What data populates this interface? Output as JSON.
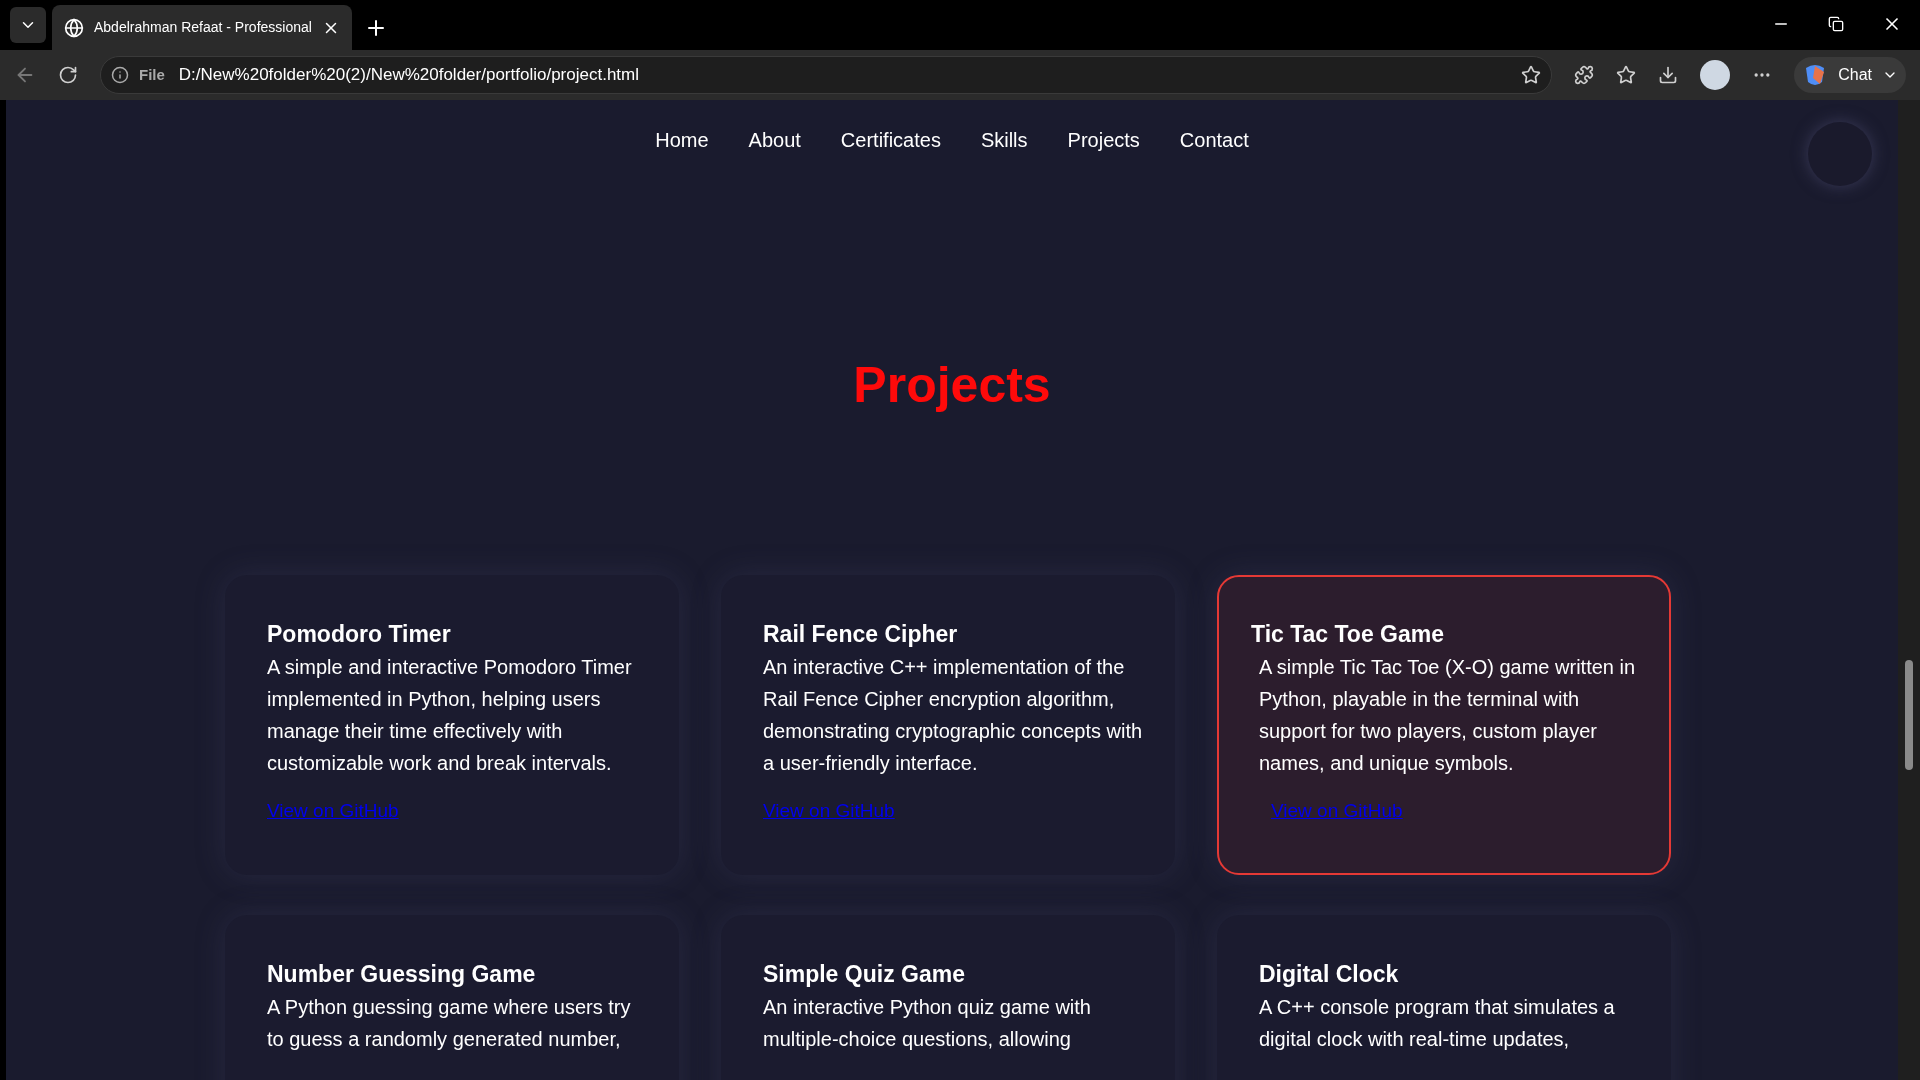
{
  "browser": {
    "tab": {
      "title": "Abdelrahman Refaat - Professional"
    },
    "address": {
      "scheme": "File",
      "url": "D:/New%20folder%20(2)/New%20folder/portfolio/project.html"
    },
    "chat_button": "Chat"
  },
  "nav": [
    {
      "label": "Home"
    },
    {
      "label": "About"
    },
    {
      "label": "Certificates"
    },
    {
      "label": "Skills"
    },
    {
      "label": "Projects"
    },
    {
      "label": "Contact"
    }
  ],
  "heading": "Projects",
  "projects": [
    {
      "title": "Pomodoro Timer",
      "description": "A simple and interactive Pomodoro Timer implemented in Python, helping users manage their time effectively with customizable work and break intervals.",
      "link": "View on GitHub",
      "highlighted": false
    },
    {
      "title": "Rail Fence Cipher",
      "description": "An interactive C++ implementation of the Rail Fence Cipher encryption algorithm, demonstrating cryptographic concepts with a user-friendly interface.",
      "link": "View on GitHub",
      "highlighted": false
    },
    {
      "title": "Tic Tac Toe Game",
      "description": "A simple Tic Tac Toe (X-O) game written in Python, playable in the terminal with support for two players, custom player names, and unique symbols.",
      "link": "View on GitHub",
      "highlighted": true
    },
    {
      "title": "Number Guessing Game",
      "description": "A Python guessing game where users try to guess a randomly generated number,",
      "highlighted": false
    },
    {
      "title": "Simple Quiz Game",
      "description": "An interactive Python quiz game with multiple-choice questions, allowing",
      "highlighted": false
    },
    {
      "title": "Digital Clock",
      "description": "A C++ console program that simulates a digital clock with real-time updates,",
      "highlighted": false
    }
  ]
}
